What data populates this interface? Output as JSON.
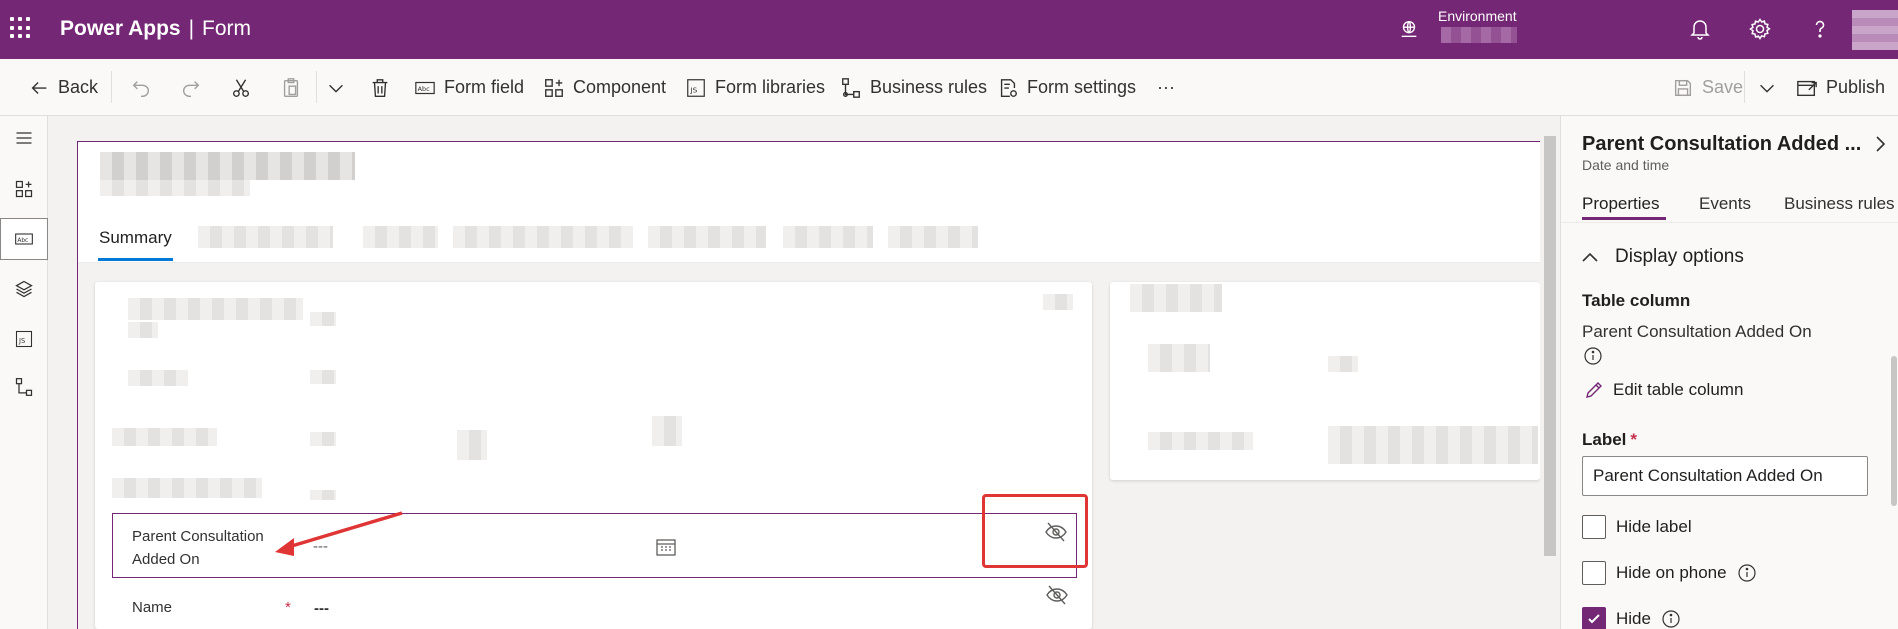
{
  "header": {
    "app_name": "Power Apps",
    "separator": "|",
    "page_name": "Form",
    "environment_label": "Environment",
    "icons": [
      "waffle-icon",
      "environment-icon",
      "bell-icon",
      "gear-icon",
      "help-icon"
    ]
  },
  "toolbar": {
    "back": "Back",
    "form_field": "Form field",
    "component": "Component",
    "form_libraries": "Form libraries",
    "business_rules": "Business rules",
    "form_settings": "Form settings",
    "more": "···",
    "save": "Save",
    "publish": "Publish"
  },
  "form": {
    "tabs": {
      "summary": "Summary"
    },
    "selected_field": {
      "label": "Parent Consultation Added On",
      "value": "---"
    },
    "name_field": {
      "label": "Name",
      "required_mark": "*",
      "value": "---"
    }
  },
  "properties_pane": {
    "title": "Parent Consultation Added ...",
    "subtitle": "Date and time",
    "tabs": [
      "Properties",
      "Events",
      "Business rules"
    ],
    "section": "Display options",
    "table_column_heading": "Table column",
    "table_column_value": "Parent Consultation Added On",
    "edit_table_column": "Edit table column",
    "label_heading": "Label",
    "label_required": "*",
    "label_value": "Parent Consultation Added On",
    "hide_label": "Hide label",
    "hide_on_phone": "Hide on phone",
    "hide": "Hide",
    "hide_label_checked": false,
    "hide_on_phone_checked": false,
    "hide_checked": true
  },
  "colors": {
    "brand": "#742774",
    "accent_tab": "#0078d4",
    "annotation": "#e03535"
  }
}
